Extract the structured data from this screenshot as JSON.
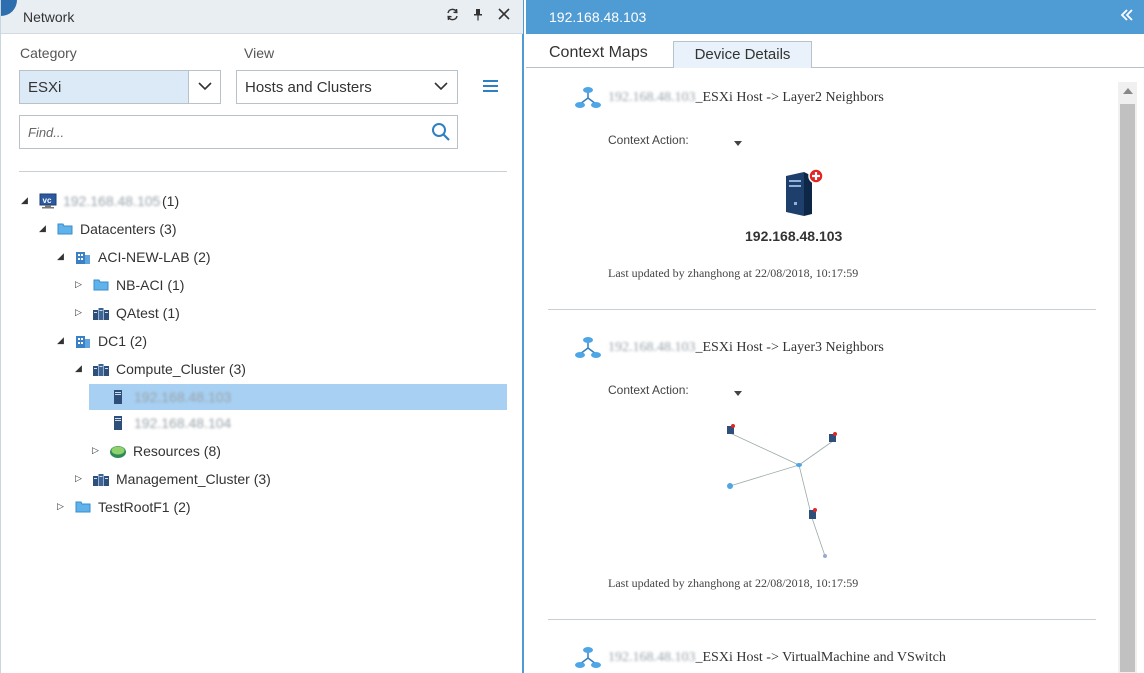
{
  "left_panel": {
    "title": "Network",
    "category_label": "Category",
    "category_value": "ESXi",
    "view_label": "View",
    "view_value": "Hosts and Clusters",
    "search_placeholder": "Find...",
    "tree": {
      "vc": {
        "label": "192.168.48.105",
        "count": "(1)"
      },
      "datacenters": "Datacenters (3)",
      "aci_new_lab": "ACI-NEW-LAB (2)",
      "nb_aci": "NB-ACI (1)",
      "qatest": "QAtest (1)",
      "dc1": "DC1 (2)",
      "compute_cluster": "Compute_Cluster (3)",
      "host_103": "192.168.48.103",
      "host_104": "192.168.48.104",
      "resources": "Resources (8)",
      "management_cluster": "Management_Cluster (3)",
      "testrootf1": "TestRootF1 (2)"
    }
  },
  "right_panel": {
    "title": "192.168.48.103",
    "tabs": [
      "Context Maps",
      "Device Details"
    ],
    "cards": [
      {
        "title_blur": "192.168.48.103",
        "title_suffix": "_ESXi Host -> Layer2 Neighbors",
        "context_action": "Context Action:",
        "device_label": "192.168.48.103",
        "updated": "Last updated by zhanghong at 22/08/2018, 10:17:59"
      },
      {
        "title_blur": "192.168.48.103",
        "title_suffix": "_ESXi Host -> Layer3 Neighbors",
        "context_action": "Context Action:",
        "updated": "Last updated by zhanghong at 22/08/2018, 10:17:59"
      },
      {
        "title_blur": "192.168.48.103",
        "title_suffix": "_ESXi Host -> VirtualMachine and VSwitch"
      }
    ]
  },
  "colors": {
    "accent": "#4f9bd4",
    "selection": "#a7d0f2",
    "category_bg": "#dce9f7"
  }
}
